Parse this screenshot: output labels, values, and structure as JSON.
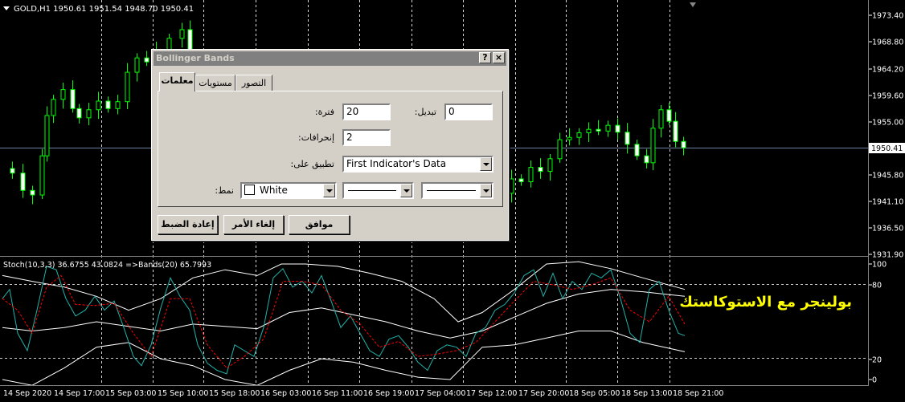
{
  "chart": {
    "header": "GOLD,H1  1950.61 1951.54 1948.70 1950.41",
    "price_ticks": [
      "1973.40",
      "1968.80",
      "1964.20",
      "1959.60",
      "1955.00",
      "1945.80",
      "1941.10",
      "1936.50",
      "1931.90"
    ],
    "current_price": "1950.41",
    "stoch_header": "Stoch(10,3,3) 36.6755 43.0824 =>Bands(20) 65.7993",
    "stoch_ticks": [
      "100",
      "80",
      "20",
      "0"
    ],
    "time_ticks": [
      "14 Sep 2020",
      "14 Sep 17:00",
      "15 Sep 03:00",
      "15 Sep 10:00",
      "15 Sep 18:00",
      "16 Sep 03:00",
      "16 Sep 11:00",
      "16 Sep 19:00",
      "17 Sep 04:00",
      "17 Sep 12:00",
      "17 Sep 20:00",
      "18 Sep 05:00",
      "18 Sep 13:00",
      "18 Sep 21:00"
    ],
    "overlay_caption": "بولينجر مع الاستوكاستك",
    "colors": {
      "bull": "#ffffff",
      "bear": "#00ff00",
      "grid": "#ffffff",
      "stoch_main": "#20b2aa",
      "stoch_signal": "#ff0000",
      "bands": "#ffffff",
      "caption": "#ffff00"
    }
  },
  "dialog": {
    "title": "Bollinger Bands",
    "help_label": "?",
    "close_label": "×",
    "tabs": [
      "معلمات",
      "مستويات",
      "التصور"
    ],
    "period_label": "فترة:",
    "period_value": "20",
    "shift_label": "تبديل:",
    "shift_value": "0",
    "deviation_label": "إنحرافات:",
    "deviation_value": "2",
    "apply_label": "تطبيق على:",
    "apply_value": "First Indicator's Data",
    "style_label": "نمط:",
    "color_value": "White",
    "ok_label": "موافق",
    "cancel_label": "إلغاء الأمر",
    "reset_label": "إعادة الضبط"
  }
}
